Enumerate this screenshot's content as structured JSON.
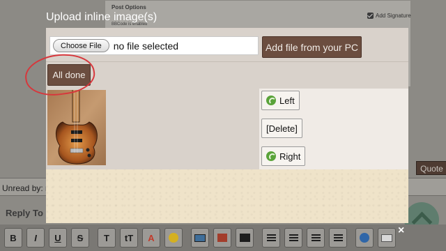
{
  "background": {
    "post_options_label": "Post Options",
    "bbcode_note": "BBCode is enabled",
    "signature_label": "Add Signature",
    "quote_label": "Quote",
    "unread_label": "Unread by: r",
    "reply_label": "Reply To",
    "toolbar": [
      "B",
      "I",
      "U",
      "S",
      "T",
      "tT",
      "A"
    ]
  },
  "modal": {
    "title": "Upload inline image(s)",
    "choose_file_label": "Choose File",
    "no_file_text": "no file selected",
    "add_file_label": "Add file from your PC",
    "all_done_label": "All done",
    "left_label": "Left",
    "delete_label": "[Delete]",
    "right_label": "Right",
    "close_label": "×"
  },
  "colors": {
    "button_brown": "#6b4d3f",
    "panel": "#d9d2cb",
    "highlight_ring": "#d7373c"
  }
}
